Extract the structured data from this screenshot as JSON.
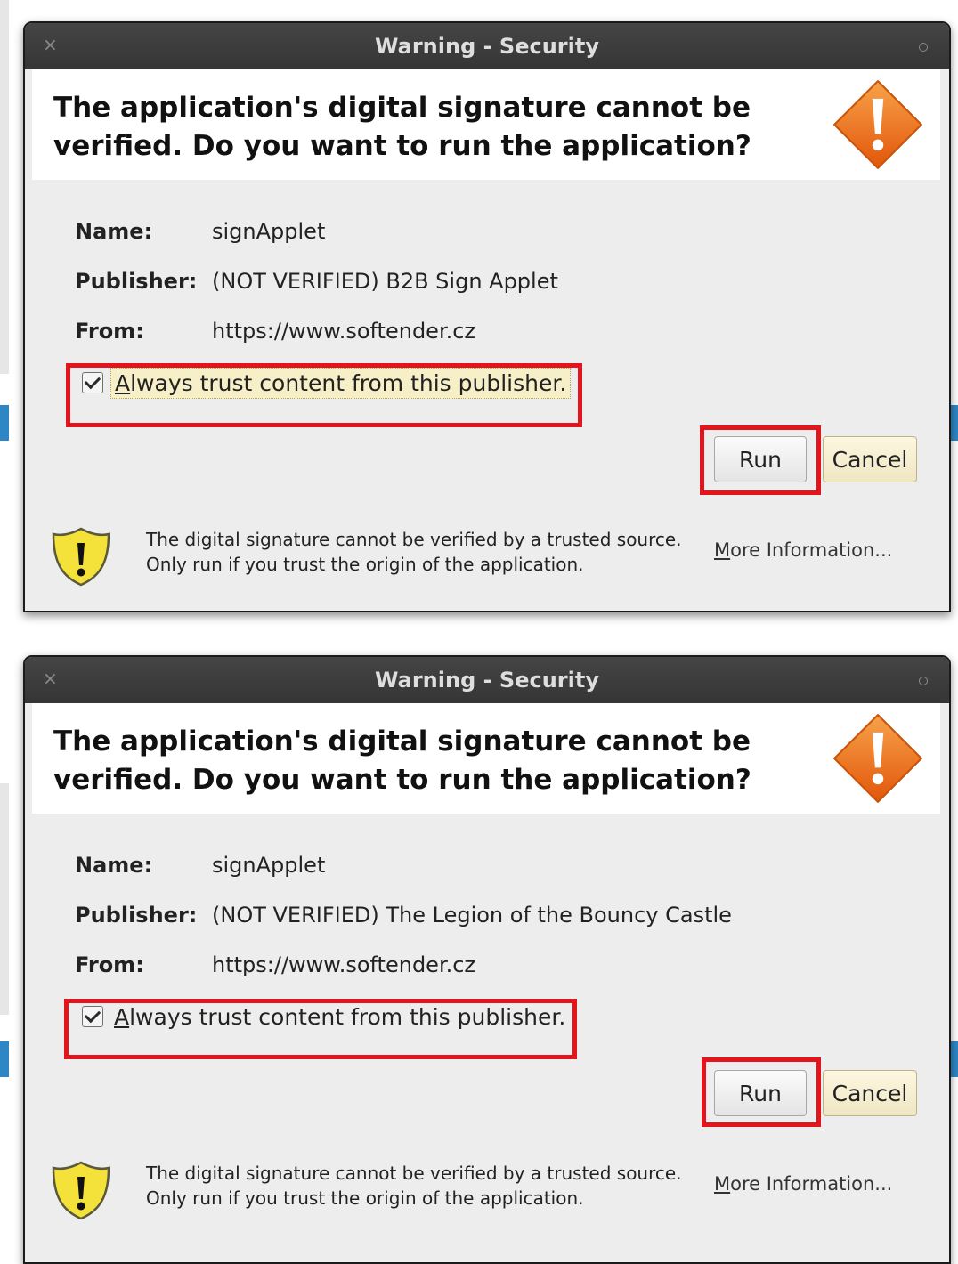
{
  "dialogs": [
    {
      "title": "Warning - Security",
      "header": "The application's digital signature cannot be verified.  Do you want to run the application?",
      "fields": [
        {
          "label": "Name:",
          "value": "signApplet"
        },
        {
          "label": "Publisher:",
          "value": "(NOT VERIFIED) B2B Sign Applet"
        },
        {
          "label": "From:",
          "value": "https://www.softender.cz"
        }
      ],
      "trust_checkbox": {
        "label_mnemonic": "A",
        "label_rest": "lways trust content from this publisher.",
        "checked": true
      },
      "run_label": "Run",
      "cancel_label": "Cancel",
      "footer_text": "The digital signature cannot be verified by a trusted source.  Only run if you trust the origin of the application.",
      "more_info": {
        "mnemonic": "M",
        "rest": "ore Information..."
      }
    },
    {
      "title": "Warning - Security",
      "header": "The application's digital signature cannot be verified.  Do you want to run the application?",
      "fields": [
        {
          "label": "Name:",
          "value": "signApplet"
        },
        {
          "label": "Publisher:",
          "value": "(NOT VERIFIED) The Legion of the Bouncy Castle"
        },
        {
          "label": "From:",
          "value": "https://www.softender.cz"
        }
      ],
      "trust_checkbox": {
        "label_mnemonic": "A",
        "label_rest": "lways trust content from this publisher.",
        "checked": true
      },
      "run_label": "Run",
      "cancel_label": "Cancel",
      "footer_text": "The digital signature cannot be verified by a trusted source.  Only run if you trust the origin of the application.",
      "more_info": {
        "mnemonic": "M",
        "rest": "ore Information..."
      }
    }
  ],
  "icons": {
    "warning": "warning-diamond-icon",
    "shield": "shield-warning-icon",
    "close": "close-icon",
    "maximize": "maximize-icon"
  },
  "colors": {
    "highlight": "#e3141b",
    "titlebar": "#3d3d3d",
    "warning_orange": "#ee6a12",
    "shield_yellow": "#f4e23a"
  }
}
